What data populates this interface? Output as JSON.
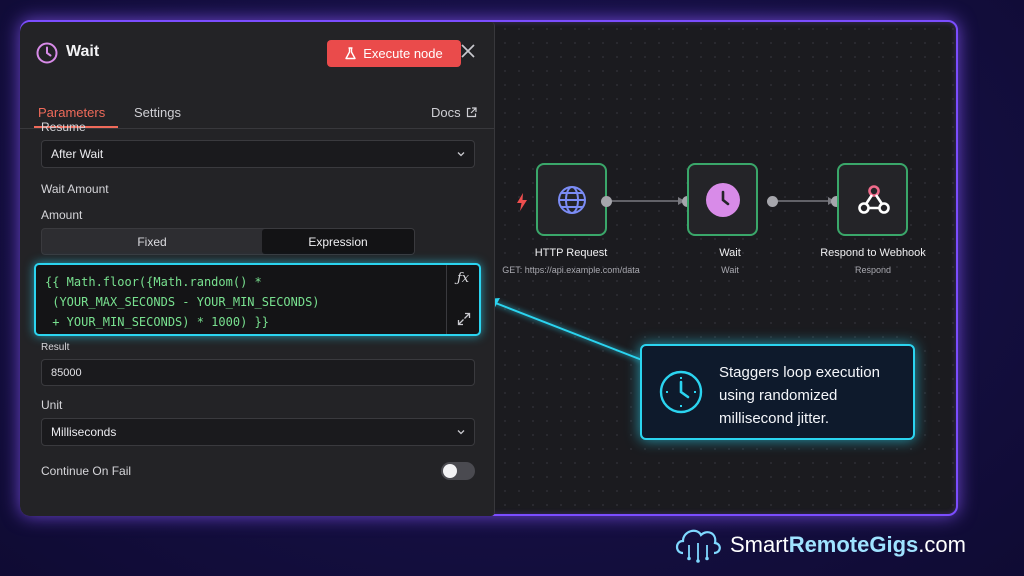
{
  "panel": {
    "title": "Wait",
    "execute_label": "Execute node",
    "tabs": {
      "parameters": "Parameters",
      "settings": "Settings",
      "docs": "Docs"
    },
    "resume": {
      "label": "Resume",
      "value": "After Wait"
    },
    "wait_amount_label": "Wait Amount",
    "amount": {
      "label": "Amount",
      "modes": [
        "Fixed",
        "Expression"
      ],
      "selected_mode": "Expression"
    },
    "expression": {
      "line1": "{{ Math.floor({Math.random() *",
      "line2": " (YOUR_MAX_SECONDS - YOUR_MIN_SECONDS)",
      "line3": " + YOUR_MIN_SECONDS) * 1000) }}"
    },
    "result": {
      "label": "Result",
      "value": "85000"
    },
    "unit": {
      "label": "Unit",
      "value": "Milliseconds"
    },
    "continue_on_fail": {
      "label": "Continue On Fail",
      "enabled": false
    }
  },
  "workflow": {
    "nodes": [
      {
        "name": "HTTP Request",
        "subtitle": "GET: https://api.example.com/data",
        "icon": "globe-icon"
      },
      {
        "name": "Wait",
        "subtitle": "Wait",
        "icon": "clock-icon"
      },
      {
        "name": "Respond to Webhook",
        "subtitle": "Respond",
        "icon": "webhook-icon"
      }
    ],
    "accent_color": "#3aa76a"
  },
  "callout": {
    "text": "Staggers loop execution using randomized millisecond jitter.",
    "icon": "clock-icon",
    "color": "#2bd4f0"
  },
  "brand": {
    "part1": "Smart",
    "part2": "RemoteGigs",
    "part3": ".com",
    "icon": "cloud-circuit-icon"
  },
  "colors": {
    "frame_glow": "#7b4dff",
    "execute": "#ea4b4b",
    "active_tab": "#ef6a5a",
    "expression_text": "#78e08f"
  }
}
